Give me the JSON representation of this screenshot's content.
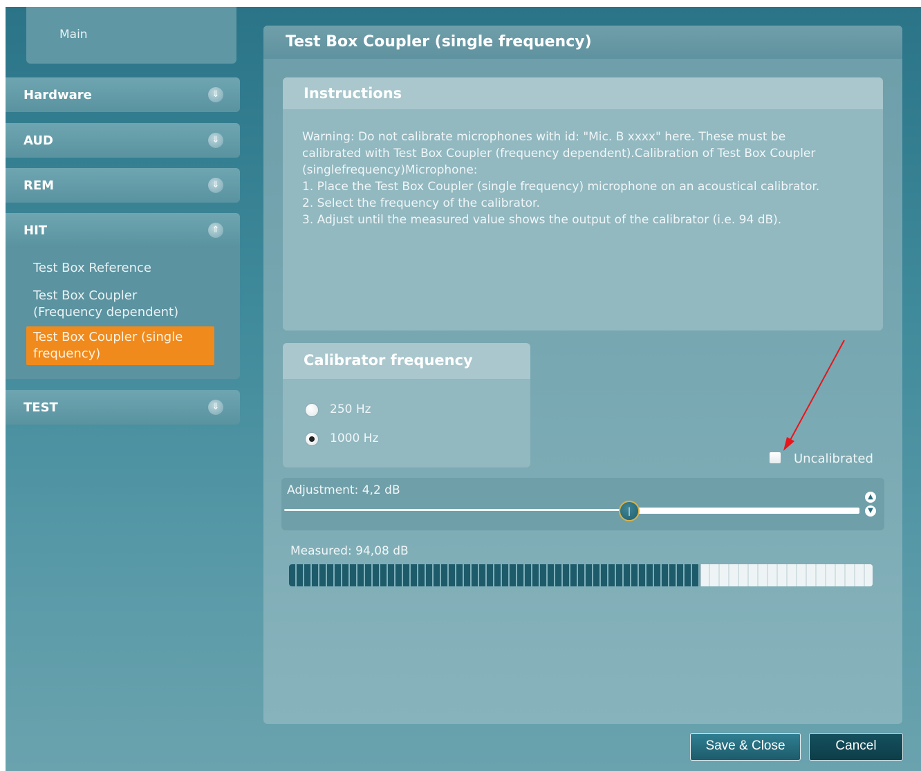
{
  "sidebar": {
    "main_label": "Main",
    "groups": [
      {
        "label": "Hardware",
        "expanded": false
      },
      {
        "label": "AUD",
        "expanded": false
      },
      {
        "label": "REM",
        "expanded": false
      },
      {
        "label": "HIT",
        "expanded": true,
        "items": [
          "Test Box Reference",
          "Test Box Coupler\n(Frequency dependent)",
          "Test Box Coupler (single\nfrequency)"
        ],
        "active_item": "Test Box Coupler (single\nfrequency)"
      },
      {
        "label": "TEST",
        "expanded": false
      }
    ],
    "icons": {
      "collapsed": "chevron-down-double-icon",
      "expanded": "chevron-up-double-icon"
    }
  },
  "panel": {
    "title": "Test Box Coupler (single frequency)",
    "instructions": {
      "heading": "Instructions",
      "lines": [
        "Warning: Do not calibrate microphones with id: \"Mic. B xxxx\" here. These must be",
        "calibrated with Test Box Coupler (frequency dependent).Calibration of Test Box Coupler",
        "(singlefrequency)Microphone:",
        "1. Place the Test Box Coupler (single frequency) microphone on an acoustical calibrator.",
        "2. Select the frequency of the calibrator.",
        "3. Adjust until the measured value shows the output of the calibrator (i.e. 94 dB)."
      ]
    },
    "calibrator": {
      "heading": "Calibrator frequency",
      "options": [
        "250 Hz",
        "1000 Hz"
      ],
      "selected": "1000 Hz"
    },
    "uncalibrated": {
      "label": "Uncalibrated",
      "checked": false
    },
    "adjustment": {
      "label": "Adjustment: 4,2 dB",
      "slider_fraction": 0.6
    },
    "measured": {
      "label": "Measured: 94,08 dB",
      "meter_fraction": 0.705
    }
  },
  "buttons": {
    "save": "Save & Close",
    "cancel": "Cancel"
  },
  "colors": {
    "accent_active": "#f08a1c",
    "window": "#3f8a9b",
    "annotation_arrow": "#e8151b"
  }
}
